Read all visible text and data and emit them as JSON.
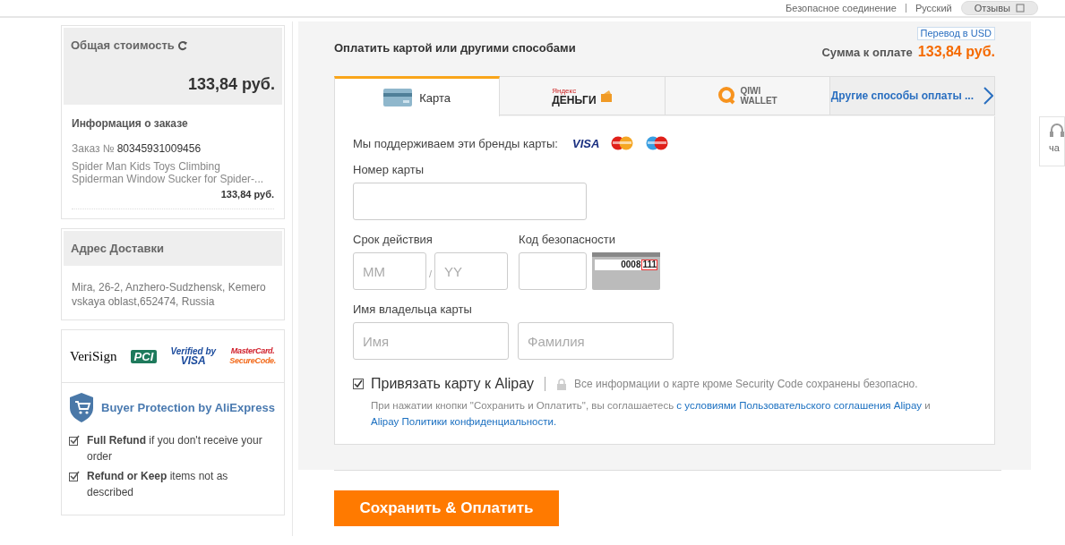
{
  "top_bar": {
    "secure_connection": "Безопасное соединение",
    "language": "Русский",
    "feedback_button": "Отзывы"
  },
  "order_summary": {
    "title": "Общая стоимость",
    "total": "133,84 руб.",
    "info_title": "Информация о заказе",
    "order_label": "Заказ №",
    "order_number": "80345931009456",
    "product": "Spider Man Kids Toys Climbing Spiderman Window Sucker for Spider-...",
    "price": "133,84 руб."
  },
  "delivery": {
    "title": "Адрес Доставки",
    "address": "Mira, 26-2, Anzhero-Sudzhensk, Kemero vskaya oblast,652474, Russia"
  },
  "security_logos": [
    {
      "kind": "verisign",
      "lines": [
        "VeriSign"
      ]
    },
    {
      "kind": "pci",
      "lines": [
        "PCI"
      ]
    },
    {
      "kind": "verified_visa",
      "lines": [
        "Verified by",
        "VISA"
      ]
    },
    {
      "kind": "securecode",
      "lines": [
        "MasterCard.",
        "SecureCode."
      ]
    }
  ],
  "buyer_protection": {
    "title": "Buyer Protection by AliExpress",
    "items": [
      {
        "text": "**Full Refund** if you don't receive your order"
      },
      {
        "text": "**Refund or Keep** items not as described"
      }
    ]
  },
  "payment": {
    "title": "Оплатить картой или другими способами",
    "convert_button": "Перевод в USD",
    "amount_label": "Сумма к оплате",
    "amount": "133,84 руб.",
    "tabs": [
      {
        "kind": "card",
        "lines": [
          "Карта"
        ],
        "selected": true
      },
      {
        "kind": "yandex",
        "lines": [
          "Яндекс",
          "ДЕНЬГИ"
        ],
        "selected": false
      },
      {
        "kind": "qiwi",
        "lines": [
          "QIWI",
          "WALLET"
        ],
        "selected": false
      },
      {
        "kind": "more",
        "lines": [
          "Другие способы оплаты ..."
        ],
        "selected": false
      }
    ],
    "brands_label": "Мы поддерживаем эти бренды карты:",
    "brands": [
      {
        "kind": "visa",
        "text": "VISA"
      },
      {
        "kind": "mastercard"
      },
      {
        "kind": "maestro"
      }
    ],
    "card_number": {
      "label": "Номер карты"
    },
    "expiry": {
      "label": "Срок действия",
      "month_placeholder": "MM",
      "separator": "/",
      "year_placeholder": "YY"
    },
    "security_code": {
      "label": "Код безопасности",
      "hint_number": "0008",
      "hint_code": "111"
    },
    "holder": {
      "label": "Имя владельца карты",
      "first_placeholder": "Имя",
      "last_placeholder": "Фамилия"
    },
    "save_card": {
      "label": "Привязать карту к Alipay",
      "checked": true
    },
    "security_note": "Все информации о карте кроме Security Code сохранены безопасно.",
    "agreement": {
      "text": "При нажатии кнопки \"Сохранить и Оплатить\", вы соглашаетесь",
      "link_terms": "с условиями Пользовательского соглашения Alipay",
      "conjunction": "и",
      "link_privacy": "Alipay Политики конфиденциальности."
    },
    "submit_button": "Сохранить & Оплатить"
  },
  "side_widget": {
    "label": "ча"
  }
}
